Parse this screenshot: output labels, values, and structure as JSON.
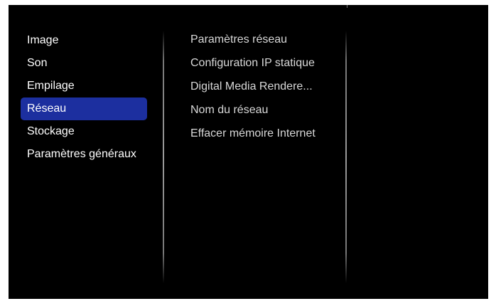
{
  "main_menu": {
    "items": [
      {
        "label": "Image"
      },
      {
        "label": "Son"
      },
      {
        "label": "Empilage"
      },
      {
        "label": "Réseau",
        "selected": true
      },
      {
        "label": "Stockage"
      },
      {
        "label": "Paramètres généraux"
      }
    ]
  },
  "submenu": {
    "items": [
      {
        "label": "Paramètres réseau"
      },
      {
        "label": "Configuration IP statique"
      },
      {
        "label": "Digital Media Rendere..."
      },
      {
        "label": "Nom du réseau"
      },
      {
        "label": "Effacer mémoire Internet"
      }
    ]
  },
  "colors": {
    "background": "#000000",
    "selected_highlight": "#1c2f9f",
    "text": "#ffffff",
    "subtext": "#d8d8d8"
  }
}
